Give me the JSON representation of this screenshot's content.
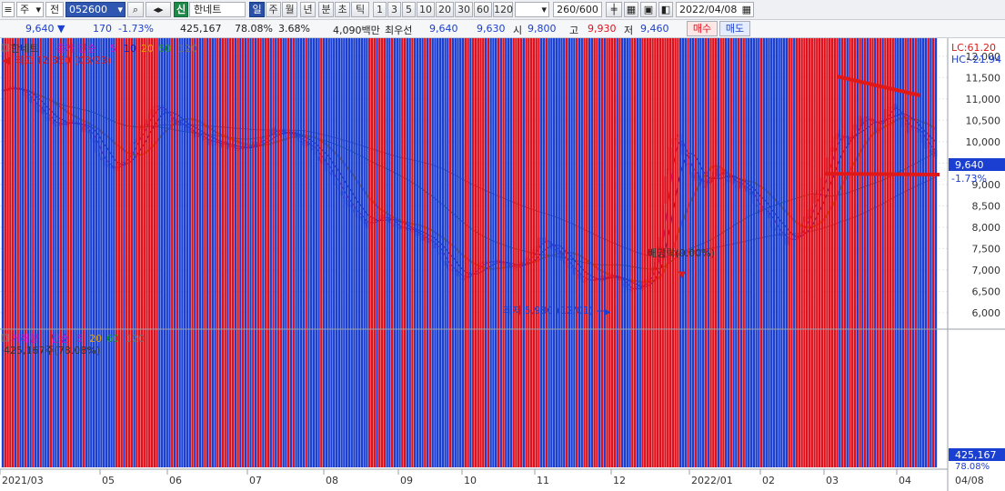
{
  "toolbar": {
    "market_select": "주",
    "type_select": "전",
    "code": "052600",
    "stock_name": "한네트",
    "periods": [
      "일",
      "주",
      "월",
      "년",
      "분",
      "초",
      "틱"
    ],
    "active_period": "일",
    "intervals": [
      "1",
      "3",
      "5",
      "10",
      "20",
      "30",
      "60",
      "120"
    ],
    "count": "260/600",
    "date": "2022/04/08"
  },
  "quote": {
    "price": "9,640",
    "change": "170",
    "change_pct": "-1.73%",
    "volume": "425,167",
    "volume_ratio": "78.08%",
    "turnover": "3.68%",
    "amount": "4,090백만",
    "best_label": "최우선",
    "ask": "9,640",
    "bid": "9,630",
    "open_label": "시",
    "open": "9,800",
    "high_label": "고",
    "high": "9,930",
    "low_label": "저",
    "low": "9,460",
    "buy_label": "매수",
    "sell_label": "매도"
  },
  "price_pane": {
    "legend_name": "한네트",
    "legend_ma_label": "종가 단순",
    "legend_ma": [
      "5",
      "10",
      "20",
      "60",
      "120"
    ],
    "high_note": "최고 12,350 (03/23)",
    "low_note": "최저 5,980 (12/01)",
    "dividend_note": "배당락(0.00%)",
    "lc": "LC:61.20",
    "hc": "HC:-21.94",
    "current_tag": "9,640",
    "current_pct": "-1.73%"
  },
  "volume_pane": {
    "legend_name": "거래량",
    "legend_ma_label": "단순",
    "legend_ma": [
      "5",
      "20",
      "60",
      "120"
    ],
    "value_note": "425,167주(78.08%)",
    "current_tag": "425,167",
    "current_pct": "78.08%"
  },
  "colors": {
    "up": "#e0101c",
    "down": "#1b3fd0",
    "ma5": "#c010c0",
    "ma10": "#1a1ab0",
    "ma20": "#e0a000",
    "ma60": "#1a9a2a",
    "ma120": "#707070"
  },
  "chart_data": {
    "type": "candlestick",
    "price_axis": {
      "ticks": [
        6000,
        6500,
        7000,
        7500,
        8000,
        8500,
        9000,
        9500,
        10000,
        10500,
        11000,
        11500,
        12000
      ],
      "min": 5700,
      "max": 12250
    },
    "volume_axis": {
      "ticks": [
        2500,
        5000,
        7500,
        10000,
        12500,
        15000
      ],
      "unit": "K",
      "min": 0,
      "max": 16000
    },
    "x_axis": {
      "labels": [
        "2021/03",
        "05",
        "06",
        "07",
        "08",
        "09",
        "10",
        "11",
        "12",
        "2022/01",
        "02",
        "03",
        "04",
        "04/08"
      ]
    },
    "close_path": [
      [
        0,
        11200
      ],
      [
        6,
        11300
      ],
      [
        12,
        10900
      ],
      [
        20,
        10400
      ],
      [
        28,
        10500
      ],
      [
        34,
        10200
      ],
      [
        40,
        9450
      ],
      [
        44,
        9350
      ],
      [
        48,
        9600
      ],
      [
        54,
        10200
      ],
      [
        60,
        10900
      ],
      [
        66,
        10500
      ],
      [
        72,
        10300
      ],
      [
        80,
        10050
      ],
      [
        90,
        9900
      ],
      [
        96,
        9850
      ],
      [
        102,
        10050
      ],
      [
        108,
        10300
      ],
      [
        114,
        10200
      ],
      [
        120,
        9950
      ],
      [
        126,
        9500
      ],
      [
        132,
        9000
      ],
      [
        138,
        8400
      ],
      [
        144,
        8000
      ],
      [
        150,
        8300
      ],
      [
        156,
        8000
      ],
      [
        162,
        7900
      ],
      [
        170,
        7600
      ],
      [
        176,
        7000
      ],
      [
        182,
        6800
      ],
      [
        190,
        7200
      ],
      [
        196,
        7200
      ],
      [
        202,
        7000
      ],
      [
        206,
        7200
      ],
      [
        212,
        7700
      ],
      [
        218,
        7500
      ],
      [
        224,
        7050
      ],
      [
        230,
        6700
      ],
      [
        236,
        6800
      ],
      [
        242,
        6900
      ],
      [
        248,
        6500
      ],
      [
        252,
        6600
      ],
      [
        256,
        6900
      ],
      [
        258,
        7200
      ],
      [
        260,
        7700
      ],
      [
        262,
        9200
      ],
      [
        264,
        9800
      ],
      [
        266,
        10200
      ],
      [
        270,
        9500
      ],
      [
        274,
        9200
      ],
      [
        278,
        9000
      ],
      [
        282,
        9300
      ],
      [
        286,
        9200
      ],
      [
        292,
        9000
      ],
      [
        298,
        8500
      ],
      [
        304,
        8100
      ],
      [
        310,
        7600
      ],
      [
        316,
        8000
      ],
      [
        322,
        8800
      ],
      [
        326,
        9500
      ],
      [
        330,
        10300
      ],
      [
        334,
        10000
      ],
      [
        338,
        10400
      ],
      [
        342,
        10600
      ],
      [
        346,
        10200
      ],
      [
        350,
        10800
      ],
      [
        354,
        10600
      ],
      [
        358,
        10300
      ],
      [
        362,
        10200
      ],
      [
        366,
        9900
      ],
      [
        369,
        9640
      ]
    ],
    "volume_spikes": [
      [
        5,
        3200
      ],
      [
        40,
        3500
      ],
      [
        66,
        5500
      ],
      [
        100,
        3000
      ],
      [
        263,
        11200
      ],
      [
        264,
        10400
      ],
      [
        270,
        8200
      ],
      [
        276,
        5400
      ],
      [
        282,
        8500
      ],
      [
        288,
        3600
      ],
      [
        302,
        3800
      ],
      [
        316,
        4000
      ],
      [
        324,
        15000
      ],
      [
        326,
        5000
      ],
      [
        334,
        8200
      ],
      [
        344,
        3500
      ],
      [
        352,
        2800
      ]
    ],
    "volume_current": 425167,
    "annotations": [
      "최고 12,350 (03/23)",
      "최저 5,980 (12/01)",
      "배당락(0.00%)"
    ]
  }
}
